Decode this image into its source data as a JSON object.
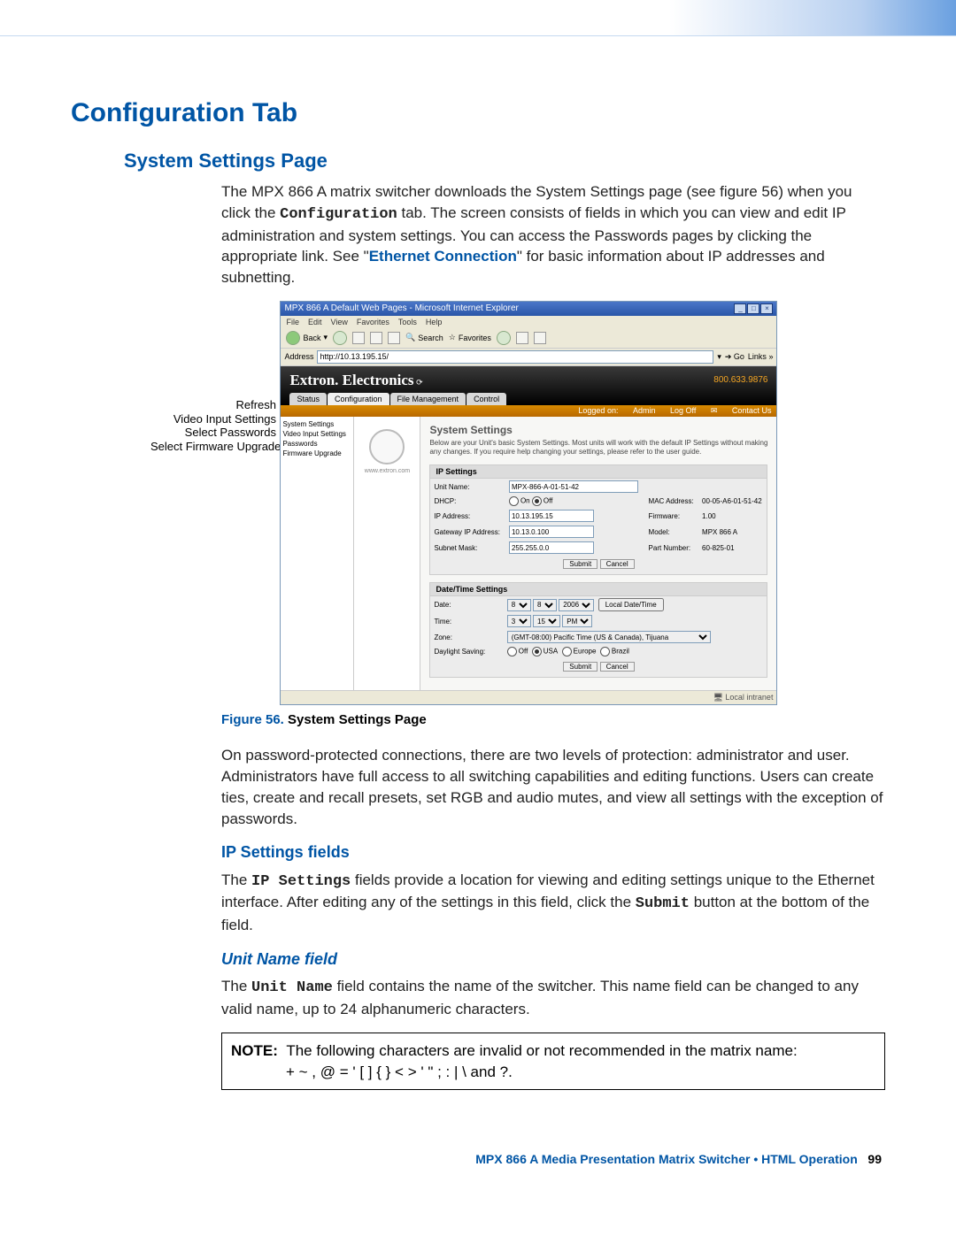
{
  "headings": {
    "h1": "Configuration Tab",
    "h2": "System Settings Page",
    "h3_ip": "IP Settings fields",
    "h3_unit": "Unit Name field"
  },
  "paragraphs": {
    "intro_a": "The MPX 866 A matrix switcher downloads the System Settings page (see figure 56) when you click the ",
    "intro_b_mono": "Configuration",
    "intro_c": " tab. The screen consists of fields in which you can view and edit IP administration and system settings. You can access the Passwords pages by clicking the appropriate link. See \"",
    "intro_link": "Ethernet Connection",
    "intro_d": "\" for basic information about IP addresses and subnetting.",
    "protect": "On password-protected connections, there are two levels of protection: administrator and user. Administrators have full access to all switching capabilities and editing functions. Users can create ties, create and recall presets, set RGB and audio mutes, and view all settings with the exception of passwords.",
    "ip_a": "The ",
    "ip_b_mono": "IP Settings",
    "ip_c": " fields provide a location for viewing and editing settings unique to the Ethernet interface. After editing any of the settings in this field, click the ",
    "ip_d_mono": "Submit",
    "ip_e": " button at the bottom of the field.",
    "unit_a": "The ",
    "unit_b_mono": "Unit Name",
    "unit_c": " field contains the name of the switcher. This name field can be changed to any valid name, up to 24 alphanumeric characters."
  },
  "note": {
    "label": "NOTE:",
    "line1": "The following characters are invalid or not recommended in the matrix name:",
    "line2": "+  ~  ,  @  =  '  [  ]  {  }  <  >  '  \"  ;  :  |  \\  and ?."
  },
  "callouts": {
    "c1": "Refresh",
    "c2": "Video Input Settings",
    "c3": "Select Passwords",
    "c4": "Select Firmware Upgrade"
  },
  "browser": {
    "title": "MPX 866 A Default Web Pages - Microsoft Internet Explorer",
    "menu": {
      "file": "File",
      "edit": "Edit",
      "view": "View",
      "fav": "Favorites",
      "tools": "Tools",
      "help": "Help"
    },
    "back": "Back",
    "search": "Search",
    "favorites": "Favorites",
    "address_label": "Address",
    "address_value": "http://10.13.195.15/",
    "go": "Go",
    "links": "Links"
  },
  "extron": {
    "brand": "Extron. Electronics",
    "phone": "800.633.9876",
    "tabs": {
      "status": "Status",
      "config": "Configuration",
      "filemgmt": "File Management",
      "control": "Control"
    },
    "logged_on": "Logged on:",
    "user": "Admin",
    "logoff": "Log Off",
    "contact": "Contact Us"
  },
  "sidebar": {
    "s1": "System Settings",
    "s2": "Video Input Settings",
    "s3": "Passwords",
    "s4": "Firmware Upgrade",
    "logo_text": "www.extron.com"
  },
  "sys": {
    "title": "System Settings",
    "desc": "Below are your Unit's basic System Settings. Most units will work with the default IP Settings without making any changes. If you require help changing your settings, please refer to the user guide."
  },
  "ip_panel": {
    "title": "IP Settings",
    "unit_name_label": "Unit Name:",
    "unit_name_value": "MPX-866-A-01-51-42",
    "dhcp_label": "DHCP:",
    "dhcp_on": "On",
    "dhcp_off": "Off",
    "mac_label": "MAC Address:",
    "mac_value": "00-05-A6-01-51-42",
    "ip_label": "IP Address:",
    "ip_value": "10.13.195.15",
    "fw_label": "Firmware:",
    "fw_value": "1.00",
    "gw_label": "Gateway IP Address:",
    "gw_value": "10.13.0.100",
    "model_label": "Model:",
    "model_value": "MPX 866 A",
    "mask_label": "Subnet Mask:",
    "mask_value": "255.255.0.0",
    "part_label": "Part Number:",
    "part_value": "60-825-01",
    "submit": "Submit",
    "cancel": "Cancel"
  },
  "dt_panel": {
    "title": "Date/Time Settings",
    "date_label": "Date:",
    "date_m": "8",
    "date_d": "8",
    "date_y": "2006",
    "local_btn": "Local Date/Time",
    "time_label": "Time:",
    "time_h": "3",
    "time_m": "15",
    "time_ap": "PM",
    "zone_label": "Zone:",
    "zone_value": "(GMT-08:00) Pacific Time (US & Canada), Tijuana",
    "ds_label": "Daylight Saving:",
    "ds_off": "Off",
    "ds_usa": "USA",
    "ds_eur": "Europe",
    "ds_bra": "Brazil",
    "submit": "Submit",
    "cancel": "Cancel"
  },
  "statusbar": {
    "zone": "Local intranet"
  },
  "figure": {
    "num": "Figure 56.",
    "title": "System Settings Page"
  },
  "footer": {
    "product": "MPX 866 A Media Presentation Matrix Switcher • HTML Operation",
    "page": "99"
  }
}
